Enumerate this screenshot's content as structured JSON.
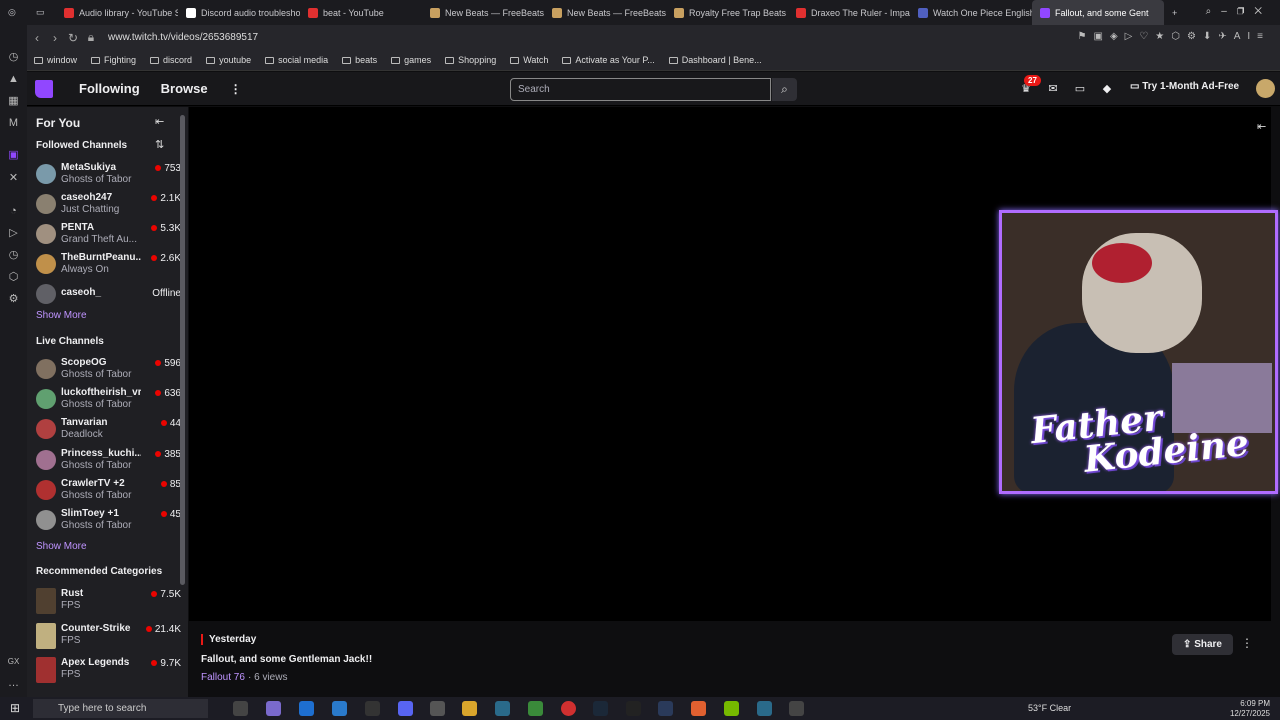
{
  "browser": {
    "tabs": [
      {
        "label": "Audio library - YouTube S",
        "color": "#e03030"
      },
      {
        "label": "Discord audio troubleshoo",
        "color": "#ffffff"
      },
      {
        "label": "beat - YouTube",
        "color": "#e03030"
      },
      {
        "label": "New Beats — FreeBeats.",
        "color": "#c8a060"
      },
      {
        "label": "New Beats — FreeBeats",
        "color": "#c8a060"
      },
      {
        "label": "Royalty Free Trap Beats",
        "color": "#c8a060"
      },
      {
        "label": "Draxeo The Ruler - Impa",
        "color": "#e03030"
      },
      {
        "label": "Watch One Piece English",
        "color": "#5060c0"
      },
      {
        "label": "Fallout, and some Gent",
        "color": "#9147ff",
        "active": true
      }
    ],
    "url": "www.twitch.tv/videos/2653689517",
    "bookmarks": [
      "window",
      "Fighting",
      "discord",
      "youtube",
      "social media",
      "beats",
      "games",
      "Shopping",
      "Watch",
      "Activate as Your P...",
      "Dashboard | Bene..."
    ]
  },
  "twitch": {
    "nav": {
      "following": "Following",
      "browse": "Browse"
    },
    "search": {
      "placeholder": "Search"
    },
    "notifications_count": "27",
    "ad_free": "Try 1-Month Ad-Free"
  },
  "sidebar": {
    "for_you": "For You",
    "followed_header": "Followed Channels",
    "followed": [
      {
        "name": "MetaSukiya",
        "game": "Ghosts of Tabor",
        "viewers": "753",
        "live": true,
        "color": "#7a9aaa"
      },
      {
        "name": "caseoh247",
        "game": "Just Chatting",
        "viewers": "2.1K",
        "live": true,
        "color": "#8a8070"
      },
      {
        "name": "PENTA",
        "game": "Grand Theft Au...",
        "viewers": "5.3K",
        "live": true,
        "color": "#a09080"
      },
      {
        "name": "TheBurntPeanu...",
        "game": "Always On",
        "viewers": "2.6K",
        "live": true,
        "color": "#c0904a"
      },
      {
        "name": "caseoh_",
        "game": "",
        "viewers": "Offline",
        "live": false,
        "color": "#606066"
      }
    ],
    "show_more": "Show More",
    "live_header": "Live Channels",
    "live": [
      {
        "name": "ScopeOG",
        "game": "Ghosts of Tabor",
        "viewers": "596",
        "color": "#807060"
      },
      {
        "name": "luckoftheirish_vr",
        "game": "Ghosts of Tabor",
        "viewers": "636",
        "color": "#60a070"
      },
      {
        "name": "Tanvarian",
        "game": "Deadlock",
        "viewers": "44",
        "color": "#b04040"
      },
      {
        "name": "Princess_kuchi...",
        "game": "Ghosts of Tabor",
        "viewers": "385",
        "color": "#a07090"
      },
      {
        "name": "CrawlerTV +2",
        "game": "Ghosts of Tabor",
        "viewers": "85",
        "color": "#b03030"
      },
      {
        "name": "SlimToey +1",
        "game": "Ghosts of Tabor",
        "viewers": "45",
        "color": "#909090"
      }
    ],
    "show_more_2": "Show More",
    "categories_header": "Recommended Categories",
    "categories": [
      {
        "name": "Rust",
        "tag": "FPS",
        "viewers": "7.5K",
        "color": "#504030"
      },
      {
        "name": "Counter-Strike",
        "tag": "FPS",
        "viewers": "21.4K",
        "color": "#c0b080"
      },
      {
        "name": "Apex Legends",
        "tag": "FPS",
        "viewers": "9.7K",
        "color": "#a03030"
      }
    ]
  },
  "video": {
    "overlay_line1": "Father",
    "overlay_line2": "Kodeine"
  },
  "info": {
    "date": "Yesterday",
    "title": "Fallout, and some Gentleman Jack!!",
    "game": "Fallout 76",
    "views": "· 6 views",
    "share": "Share"
  },
  "taskbar": {
    "search_placeholder": "Type here to search",
    "weather": "53°F  Clear",
    "time": "6:09 PM",
    "date": "12/27/2025"
  }
}
